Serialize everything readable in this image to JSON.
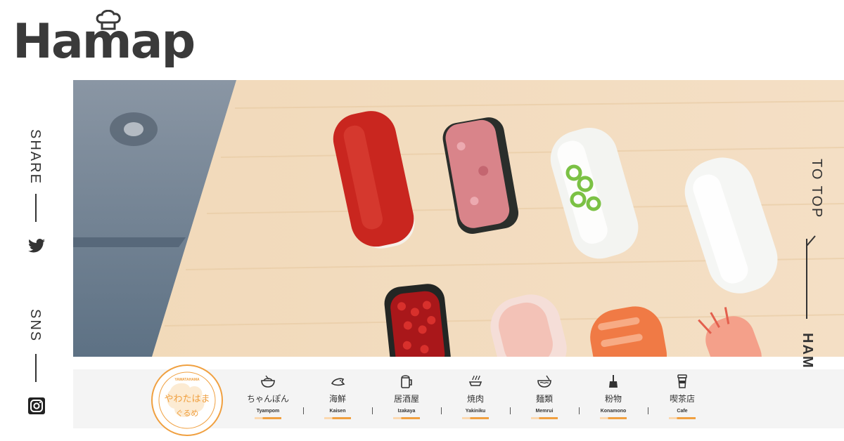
{
  "brand": {
    "logo_text": "Hamap",
    "logo_color": "#3a3a3a"
  },
  "left_rail": {
    "share_label": "SHARE",
    "sns_label": "SNS"
  },
  "right_rail": {
    "totop_label": "TO TOP",
    "brand_label": "HAMAP"
  },
  "badge": {
    "label": "やわたはま ぐるめ",
    "ring_text": "YAWATAHAMA YAWATAHAMA YAWATAHAMA",
    "color": "#f0a040"
  },
  "categories": [
    {
      "name": "ちゃんぽん",
      "roman": "Tyampom",
      "icon": "ramen-bowl-icon"
    },
    {
      "name": "海鮮",
      "roman": "Kaisen",
      "icon": "fish-icon"
    },
    {
      "name": "居酒屋",
      "roman": "Izakaya",
      "icon": "beer-mug-icon"
    },
    {
      "name": "焼肉",
      "roman": "Yakiniku",
      "icon": "grill-icon"
    },
    {
      "name": "麺類",
      "roman": "Memrui",
      "icon": "noodle-bowl-icon"
    },
    {
      "name": "粉物",
      "roman": "Konamono",
      "icon": "spatula-icon"
    },
    {
      "name": "喫茶店",
      "roman": "Cafe",
      "icon": "coffee-cup-icon"
    }
  ],
  "accent_color": "#f0a040"
}
